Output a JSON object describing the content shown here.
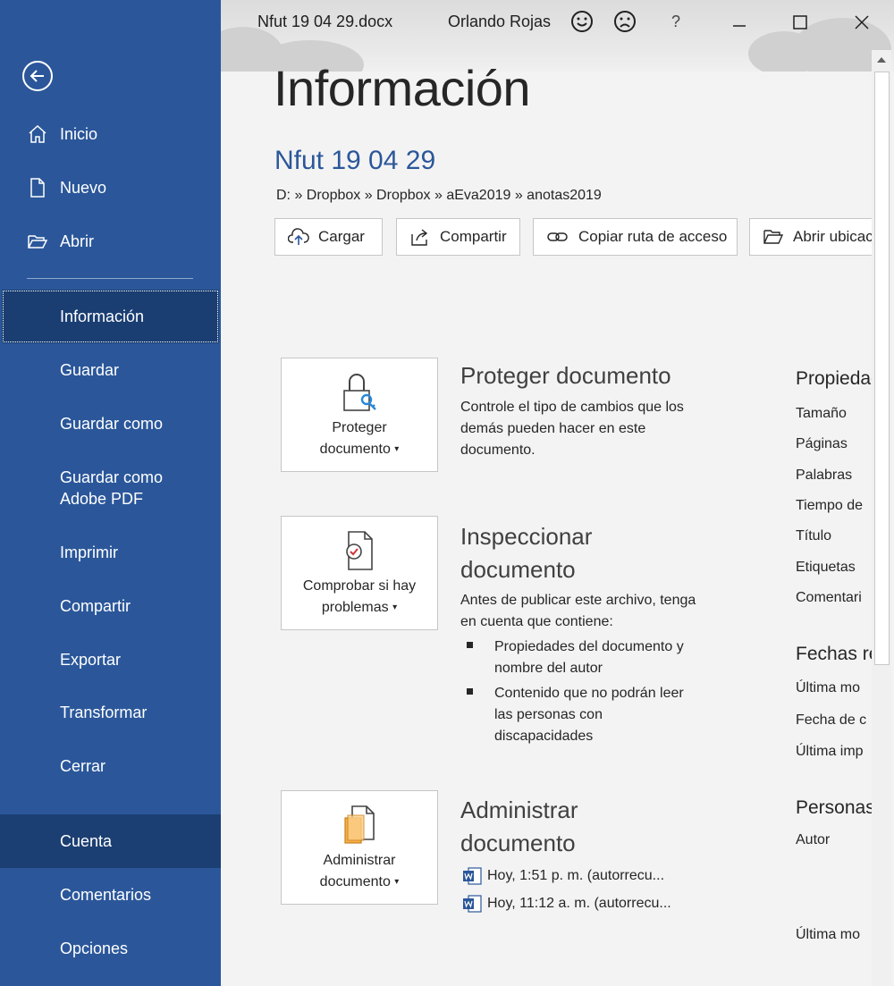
{
  "titlebar": {
    "filename": "Nfut 19 04 29.docx",
    "user": "Orlando Rojas",
    "help": "?"
  },
  "sidebar": {
    "items": [
      {
        "label": "Inicio",
        "icon": "home-icon"
      },
      {
        "label": "Nuevo",
        "icon": "new-document-icon"
      },
      {
        "label": "Abrir",
        "icon": "open-folder-icon"
      },
      {
        "label": "Información"
      },
      {
        "label": "Guardar"
      },
      {
        "label": "Guardar como"
      },
      {
        "label": "Guardar como Adobe PDF"
      },
      {
        "label": "Imprimir"
      },
      {
        "label": "Compartir"
      },
      {
        "label": "Exportar"
      },
      {
        "label": "Transformar"
      },
      {
        "label": "Cerrar"
      },
      {
        "label": "Cuenta"
      },
      {
        "label": "Comentarios"
      },
      {
        "label": "Opciones"
      }
    ]
  },
  "main": {
    "title": "Información",
    "doc_title": "Nfut 19 04 29",
    "breadcrumb": "D: » Dropbox » Dropbox » aEva2019 » anotas2019",
    "actions": [
      "Cargar",
      "Compartir",
      "Copiar ruta de acceso",
      "Abrir ubicación"
    ],
    "protect": {
      "button_line1": "Proteger",
      "button_line2": "documento",
      "title": "Proteger documento",
      "desc": "Controle el tipo de cambios que los demás pueden hacer en este documento."
    },
    "inspect": {
      "button_line1": "Comprobar si hay",
      "button_line2": "problemas",
      "title_line1": "Inspeccionar",
      "title_line2": "documento",
      "desc": "Antes de publicar este archivo, tenga en cuenta que contiene:",
      "bullets": [
        "Propiedades del documento y nombre del autor",
        "Contenido que no podrán leer las personas con discapacidades"
      ]
    },
    "manage": {
      "button_line1": "Administrar",
      "button_line2": "documento",
      "title_line1": "Administrar",
      "title_line2": "documento",
      "versions": [
        "Hoy, 1:51 p. m. (autorrecu...",
        "Hoy, 11:12 a. m. (autorrecu..."
      ]
    }
  },
  "properties": {
    "header": "Propiedades",
    "labels": [
      "Tamaño",
      "Páginas",
      "Palabras",
      "Tiempo de",
      "Título",
      "Etiquetas",
      "Comentari"
    ],
    "dates_header": "Fechas re",
    "dates_labels": [
      "Última mo",
      "Fecha de c",
      "Última imp"
    ],
    "people_header": "Personas",
    "people_labels": [
      "Autor"
    ],
    "last_label": "Última mo"
  },
  "colors": {
    "sidebar": "#2b579a",
    "active": "#1a3e72",
    "accent": "#2b579a"
  }
}
